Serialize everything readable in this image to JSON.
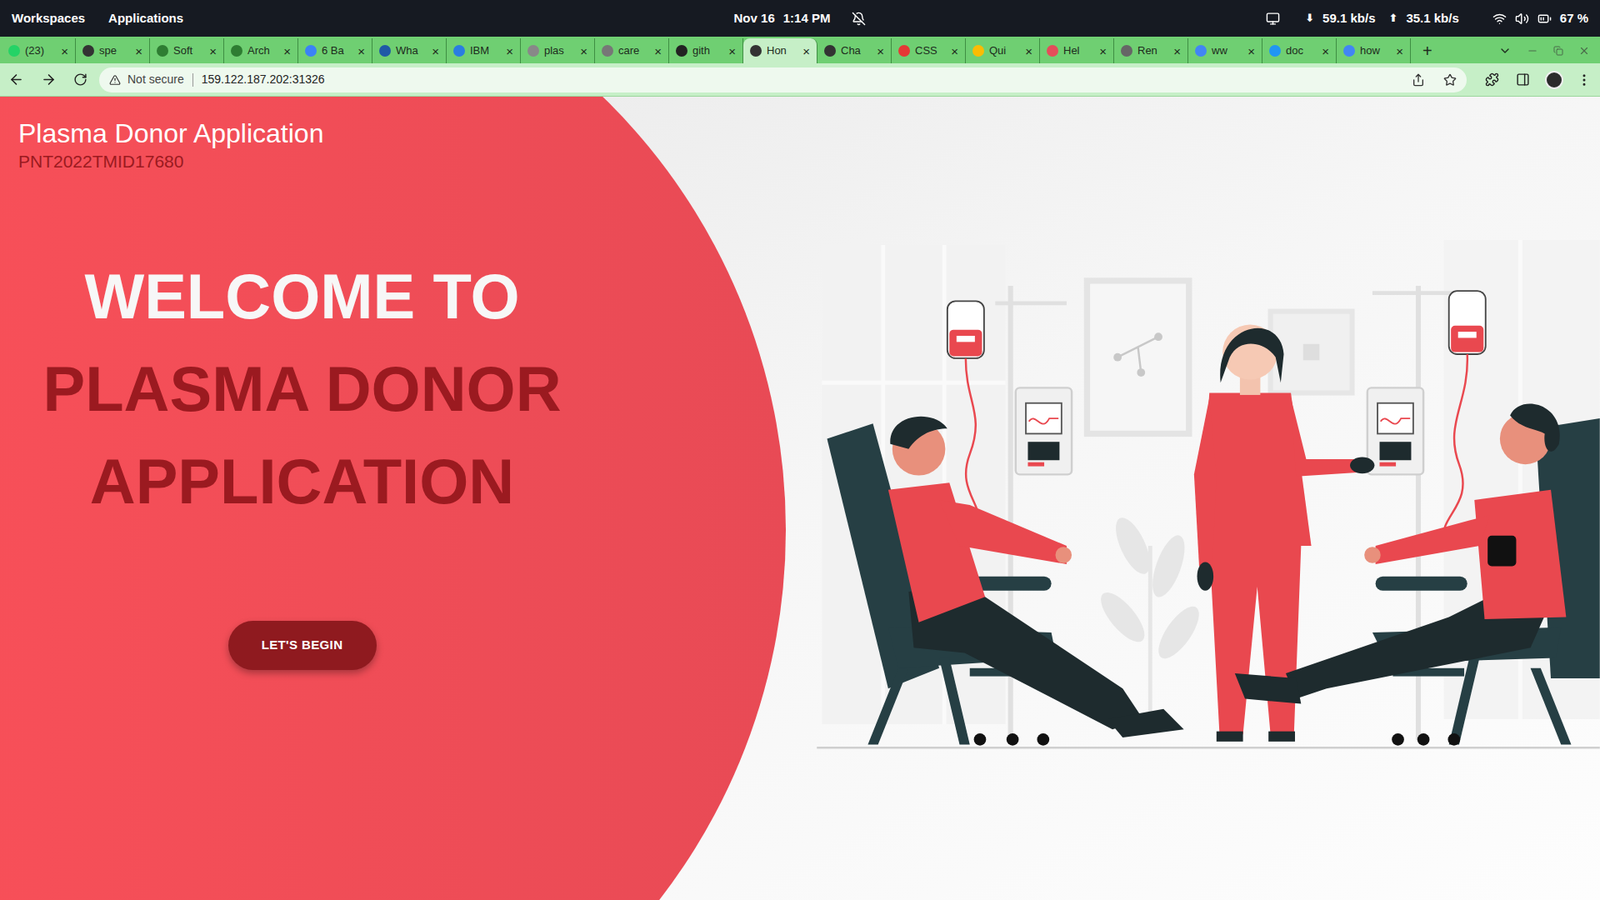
{
  "system_bar": {
    "workspaces": "Workspaces",
    "applications": "Applications",
    "date": "Nov 16",
    "time": "1:14 PM",
    "download_arrow": "⬇",
    "download": "59.1 kb/s",
    "upload_arrow": "⬆",
    "upload": "35.1 kb/s",
    "battery": "67 %"
  },
  "tabs": [
    {
      "label": "(23)",
      "selected": false,
      "color": "#25d366"
    },
    {
      "label": "spe",
      "selected": false,
      "color": "#333333"
    },
    {
      "label": "Soft",
      "selected": false,
      "color": "#2e7d32"
    },
    {
      "label": "Arch",
      "selected": false,
      "color": "#2e7d32"
    },
    {
      "label": "6 Ba",
      "selected": false,
      "color": "#3b82f6"
    },
    {
      "label": "Wha",
      "selected": false,
      "color": "#1f5aa6"
    },
    {
      "label": "IBM",
      "selected": false,
      "color": "#2a7de1"
    },
    {
      "label": "plas",
      "selected": false,
      "color": "#888888"
    },
    {
      "label": "care",
      "selected": false,
      "color": "#777777"
    },
    {
      "label": "gith",
      "selected": false,
      "color": "#222222"
    },
    {
      "label": "Hon",
      "selected": true,
      "color": "#333333"
    },
    {
      "label": "Cha",
      "selected": false,
      "color": "#333333"
    },
    {
      "label": "CSS",
      "selected": false,
      "color": "#e53935"
    },
    {
      "label": "Qui",
      "selected": false,
      "color": "#fbbc04"
    },
    {
      "label": "Hel",
      "selected": false,
      "color": "#e44d5a"
    },
    {
      "label": "Ren",
      "selected": false,
      "color": "#666666"
    },
    {
      "label": "ww",
      "selected": false,
      "color": "#4285f4"
    },
    {
      "label": "doc",
      "selected": false,
      "color": "#2196f3"
    },
    {
      "label": "how",
      "selected": false,
      "color": "#4285f4"
    }
  ],
  "tab_close": "×",
  "new_tab": "+",
  "address_bar": {
    "security": "Not secure",
    "url": "159.122.187.202:31326"
  },
  "page": {
    "brand": "Plasma Donor Application",
    "code": "PNT2022TMID17680",
    "heading": [
      {
        "text": "WELCOME TO",
        "color": "#f7f7f7"
      },
      {
        "text": "PLASMA DONOR",
        "color": "#9b1a20"
      },
      {
        "text": "APPLICATION",
        "color": "#9b1a20"
      }
    ],
    "button": "LET'S BEGIN"
  }
}
